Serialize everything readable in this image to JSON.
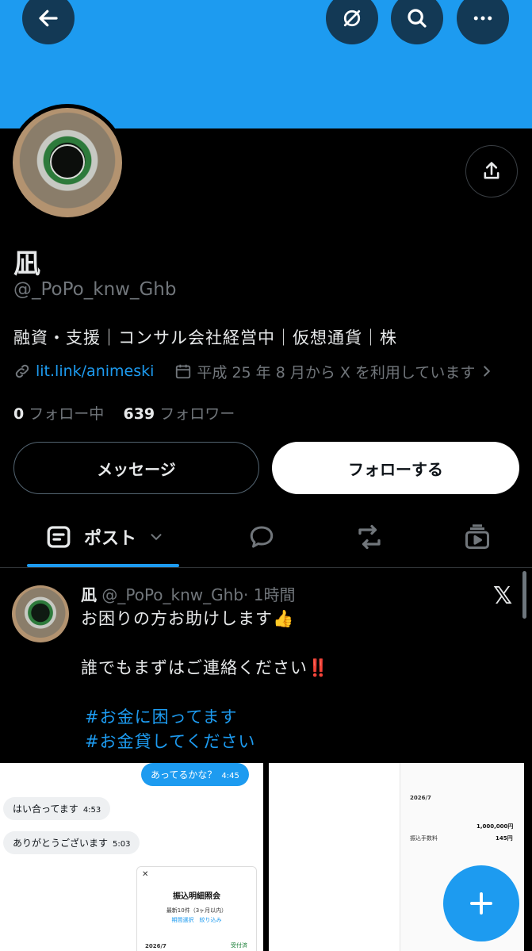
{
  "colors": {
    "accent": "#1d9bf0",
    "banner": "#1d9bf0",
    "background": "#000000",
    "secondary_text": "#71767b"
  },
  "header": {
    "back_icon": "arrow-left-icon",
    "grok_icon": "slash-circle-icon",
    "search_icon": "search-icon",
    "more_icon": "more-horizontal-icon"
  },
  "profile": {
    "name": "凪",
    "handle": "@_PoPo_knw_Ghb",
    "bio": "融資・支援｜コンサル会社経営中｜仮想通貨｜株",
    "link": "lit.link/animeski",
    "joined": "平成 25 年 8 月から X を利用しています",
    "following_count": "0",
    "following_label": "フォロー中",
    "followers_count": "639",
    "followers_label": "フォロワー",
    "message_label": "メッセージ",
    "follow_label": "フォローする"
  },
  "tabs": {
    "posts_label": "ポスト"
  },
  "post": {
    "name": "凪",
    "handle": "@_PoPo_knw_Ghb",
    "time": "· 1時間",
    "line1": "お困りの方お助けします👍",
    "line2": "誰でもまずはご連絡ください‼️",
    "hashtag1": "#お金に困ってます",
    "hashtag2": "#お金貸してください",
    "chat": {
      "msg1": "あってるかな？",
      "msg1_time": "4:45",
      "msg2": "はい合ってます",
      "msg2_time": "4:53",
      "msg3": "ありがとうございます",
      "msg3_time": "5:03",
      "card_title": "振込明細照会",
      "card_sub": "最新10件（3ヶ月以内）",
      "card_filter": "期間選択　絞り込み",
      "card_date": "2026/7",
      "card_status": "受付済"
    },
    "doc": {
      "amount": "1,000,000円",
      "fee_label": "振込手数料",
      "fee": "145円",
      "date": "2026/7"
    }
  }
}
